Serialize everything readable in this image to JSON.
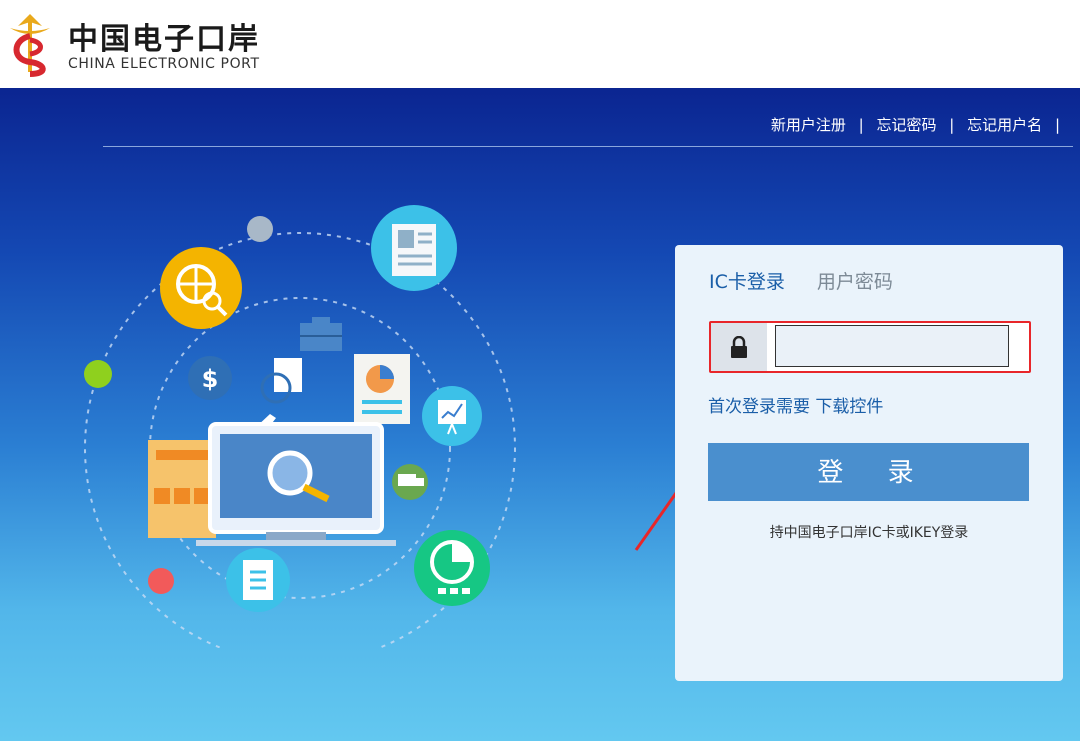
{
  "header": {
    "logo_cn": "中国电子口岸",
    "logo_en": "CHINA ELECTRONIC PORT"
  },
  "top_links": [
    {
      "label": "新用户注册"
    },
    {
      "label": "忘记密码"
    },
    {
      "label": "忘记用户名"
    }
  ],
  "separator": "|",
  "login": {
    "tabs": [
      {
        "label": "IC卡登录",
        "active": true
      },
      {
        "label": "用户密码",
        "active": false
      }
    ],
    "ic_input_value": "",
    "first_login_text": "首次登录需要",
    "download_link": "下载控件",
    "button_label": "登 录",
    "hint": "持中国电子口岸IC卡或IKEY登录"
  },
  "colors": {
    "accent": "#1a5ea8",
    "button": "#4a8fce",
    "highlight": "#e8262a",
    "hero_top": "#0b2591",
    "hero_bottom": "#63c8f0"
  },
  "icons": [
    "lock-icon",
    "globe-search-icon",
    "resume-icon",
    "airplane-icon",
    "briefcase-icon",
    "dollar-icon",
    "document-chart-icon",
    "presentation-icon",
    "truck-icon",
    "monitor-search-icon",
    "clipboard-icon",
    "pie-chart-icon",
    "calendar-icon"
  ]
}
